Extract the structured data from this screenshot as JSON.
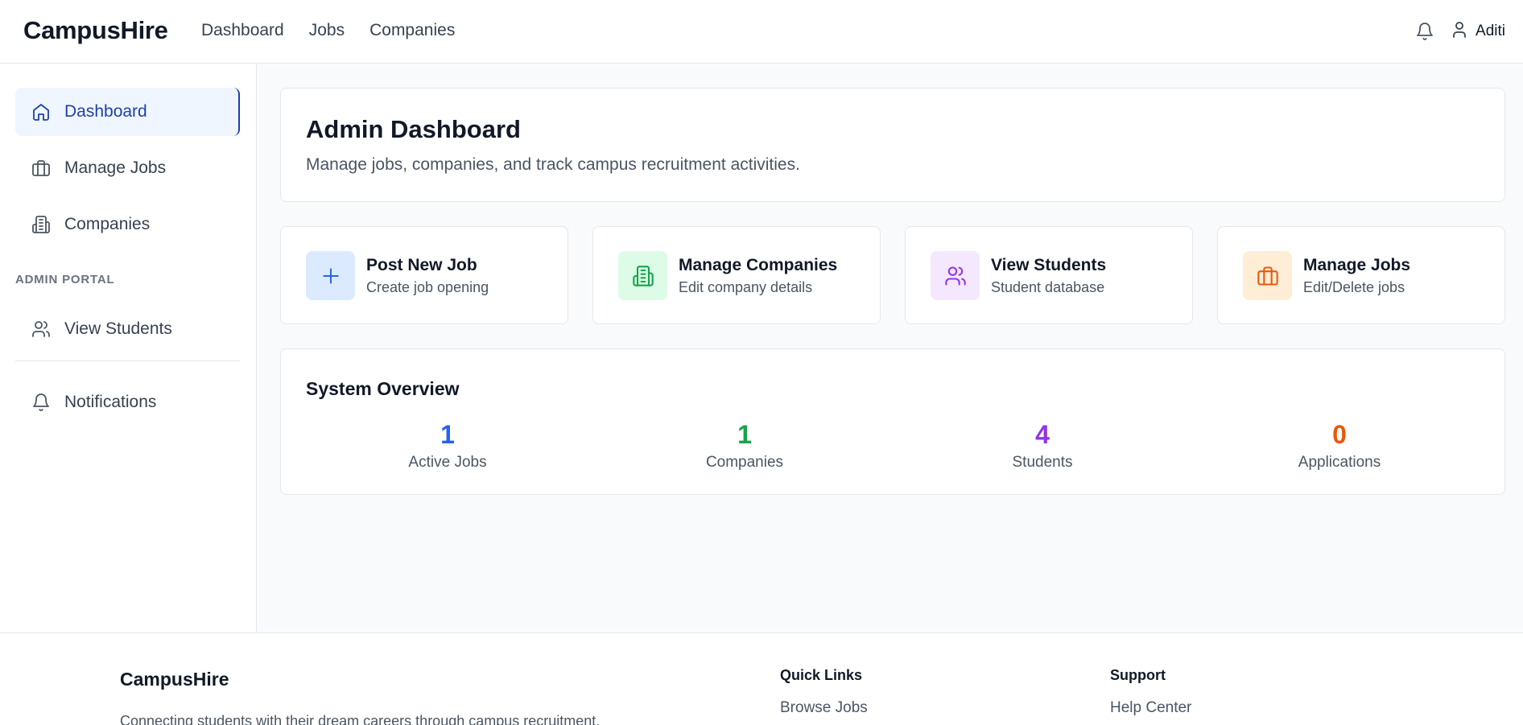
{
  "app": {
    "brand": "CampusHire"
  },
  "topnav": {
    "items": [
      {
        "label": "Dashboard"
      },
      {
        "label": "Jobs"
      },
      {
        "label": "Companies"
      }
    ]
  },
  "user": {
    "name": "Aditi"
  },
  "sidebar": {
    "items": [
      {
        "label": "Dashboard",
        "icon": "home-icon",
        "active": true
      },
      {
        "label": "Manage Jobs",
        "icon": "briefcase-icon"
      },
      {
        "label": "Companies",
        "icon": "building-icon"
      }
    ],
    "section_label": "ADMIN PORTAL",
    "admin_items": [
      {
        "label": "View Students",
        "icon": "users-icon"
      }
    ],
    "bottom_items": [
      {
        "label": "Notifications",
        "icon": "bell-icon"
      }
    ]
  },
  "header": {
    "title": "Admin Dashboard",
    "subtitle": "Manage jobs, companies, and track campus recruitment activities."
  },
  "quick_actions": [
    {
      "title": "Post New Job",
      "subtitle": "Create job opening",
      "icon": "plus-icon",
      "bg": "#dbeafe",
      "color": "#2563eb"
    },
    {
      "title": "Manage Companies",
      "subtitle": "Edit company details",
      "icon": "building-icon",
      "bg": "#dcfce7",
      "color": "#16a34a"
    },
    {
      "title": "View Students",
      "subtitle": "Student database",
      "icon": "users-icon",
      "bg": "#f3e8ff",
      "color": "#9333ea"
    },
    {
      "title": "Manage Jobs",
      "subtitle": "Edit/Delete jobs",
      "icon": "briefcase-icon",
      "bg": "#ffedd5",
      "color": "#ea580c"
    }
  ],
  "overview": {
    "title": "System Overview",
    "stats": [
      {
        "value": "1",
        "label": "Active Jobs",
        "color": "#2563eb"
      },
      {
        "value": "1",
        "label": "Companies",
        "color": "#16a34a"
      },
      {
        "value": "4",
        "label": "Students",
        "color": "#9333ea"
      },
      {
        "value": "0",
        "label": "Applications",
        "color": "#ea580c"
      }
    ]
  },
  "footer": {
    "brand": "CampusHire",
    "tagline": "Connecting students with their dream careers through campus recruitment.",
    "quick_links": {
      "heading": "Quick Links",
      "items": [
        "Browse Jobs"
      ]
    },
    "support": {
      "heading": "Support",
      "items": [
        "Help Center"
      ]
    }
  }
}
